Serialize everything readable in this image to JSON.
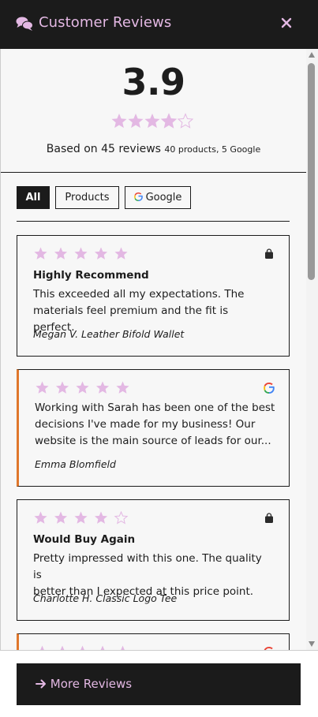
{
  "header": {
    "title": "Customer Reviews",
    "icon": "chat-bubbles-icon",
    "close_icon": "close-icon"
  },
  "summary": {
    "rating": "3.9",
    "rating_value": 3.9,
    "based_on": "Based on 45 reviews",
    "breakdown": "40 products, 5 Google"
  },
  "filters": [
    {
      "label": "All",
      "active": true
    },
    {
      "label": "Products",
      "active": false
    },
    {
      "label": "Google",
      "active": false
    }
  ],
  "reviews": [
    {
      "rating": 5,
      "source": "product",
      "title": "Highly Recommend",
      "body": [
        "This exceeded all my expectations. The",
        "materials feel premium and the fit is perfect."
      ],
      "author": "Megan V. Leather Bifold Wallet"
    },
    {
      "rating": 5,
      "source": "google",
      "title": "",
      "body": [
        "Working with Sarah has been one of the best",
        "decisions I've made for my business! Our",
        "website is the main source of leads for our..."
      ],
      "author": "Emma Blomfield"
    },
    {
      "rating": 4,
      "source": "product",
      "title": "Would Buy Again",
      "body": [
        "Pretty impressed with this one. The quality is",
        "better than I expected at this price point."
      ],
      "author": "Charlotte H. Classic Logo Tee"
    },
    {
      "rating": 5,
      "source": "google",
      "title": "",
      "body": [],
      "author": ""
    }
  ],
  "footer": {
    "more_label": "More Reviews",
    "arrow_icon": "arrow-right-icon"
  },
  "colors": {
    "accent": "#e3b8e3",
    "dark": "#1b1b1b",
    "google_border": "#e0772c",
    "star_filled": "#e3b8e3"
  }
}
